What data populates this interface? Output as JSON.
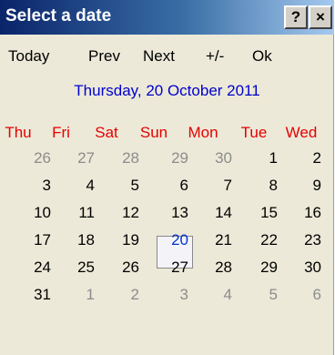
{
  "window": {
    "title": "Select a date",
    "help_label": "?",
    "close_label": "×"
  },
  "toolbar": {
    "today": "Today",
    "prev": "Prev",
    "next": "Next",
    "plusminus": "+/-",
    "ok": "Ok"
  },
  "current_date": "Thursday, 20 October 2011",
  "weekdays": [
    "Thu",
    "Fri",
    "Sat",
    "Sun",
    "Mon",
    "Tue",
    "Wed"
  ],
  "weeks": [
    [
      {
        "d": "26",
        "o": true
      },
      {
        "d": "27",
        "o": true
      },
      {
        "d": "28",
        "o": true
      },
      {
        "d": "29",
        "o": true
      },
      {
        "d": "30",
        "o": true
      },
      {
        "d": "1"
      },
      {
        "d": "2"
      }
    ],
    [
      {
        "d": "3"
      },
      {
        "d": "4"
      },
      {
        "d": "5"
      },
      {
        "d": "6"
      },
      {
        "d": "7"
      },
      {
        "d": "8"
      },
      {
        "d": "9"
      }
    ],
    [
      {
        "d": "10"
      },
      {
        "d": "11"
      },
      {
        "d": "12"
      },
      {
        "d": "13"
      },
      {
        "d": "14"
      },
      {
        "d": "15"
      },
      {
        "d": "16"
      }
    ],
    [
      {
        "d": "17"
      },
      {
        "d": "18"
      },
      {
        "d": "19"
      },
      {
        "d": "20",
        "selected": true
      },
      {
        "d": "21"
      },
      {
        "d": "22"
      },
      {
        "d": "23"
      }
    ],
    [
      {
        "d": "24"
      },
      {
        "d": "25"
      },
      {
        "d": "26"
      },
      {
        "d": "27"
      },
      {
        "d": "28"
      },
      {
        "d": "29"
      },
      {
        "d": "30"
      }
    ],
    [
      {
        "d": "31"
      },
      {
        "d": "1",
        "o": true
      },
      {
        "d": "2",
        "o": true
      },
      {
        "d": "3",
        "o": true
      },
      {
        "d": "4",
        "o": true
      },
      {
        "d": "5",
        "o": true
      },
      {
        "d": "6",
        "o": true
      }
    ]
  ],
  "colors": {
    "weekday_header": "#e60000",
    "current_date": "#0000cc",
    "other_month": "#8c8c8c",
    "selected_day": "#0033cc"
  }
}
